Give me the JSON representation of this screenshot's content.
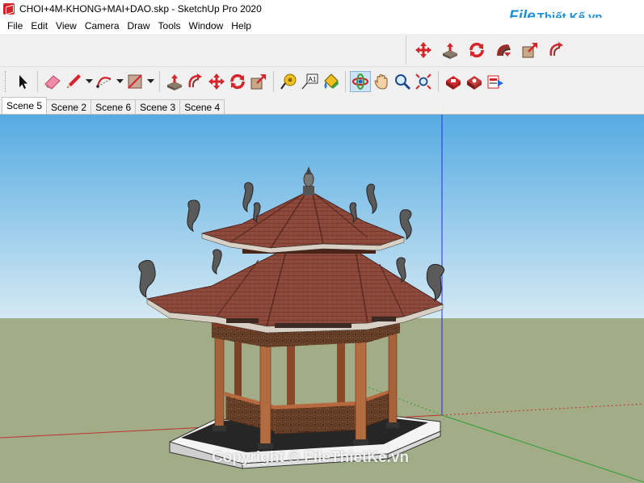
{
  "window": {
    "title": "CHOI+4M-KHONG+MAI+DAO.skp - SketchUp Pro 2020"
  },
  "brand": {
    "file": "File",
    "rest": "Thiết Kế.vn"
  },
  "menu": [
    "File",
    "Edit",
    "View",
    "Camera",
    "Draw",
    "Tools",
    "Window",
    "Help"
  ],
  "toolbar_top": [
    "move-icon",
    "push-pull-icon",
    "rotate-icon",
    "follow-me-icon",
    "scale-icon",
    "offset-icon"
  ],
  "toolbar_main": {
    "tools": [
      "select-icon",
      "eraser-icon",
      "pencil-icon",
      "arc-icon",
      "rectangle-icon",
      "push-pull-icon",
      "follow-me-icon",
      "move-icon",
      "rotate-icon",
      "scale-icon",
      "tape-measure-icon",
      "text-icon",
      "paint-bucket-icon",
      "orbit-icon",
      "pan-icon",
      "zoom-icon",
      "zoom-extents-icon",
      "warehouse-icon",
      "extension-warehouse-icon",
      "send-layout-icon"
    ],
    "text_tool_label": "A1"
  },
  "scenes": [
    {
      "label": "Scene 5",
      "active": true
    },
    {
      "label": "Scene 2",
      "active": false
    },
    {
      "label": "Scene 6",
      "active": false
    },
    {
      "label": "Scene 3",
      "active": false
    },
    {
      "label": "Scene 4",
      "active": false
    }
  ],
  "watermark": "Copyright © FileThietKe.vn",
  "colors": {
    "sky_top": "#5aaee3",
    "sky_bottom": "#cfe6f2",
    "ground": "#a2ad88",
    "roof": "#8e4a3c",
    "wood": "#a8623a",
    "accent_red": "#d4252b"
  }
}
